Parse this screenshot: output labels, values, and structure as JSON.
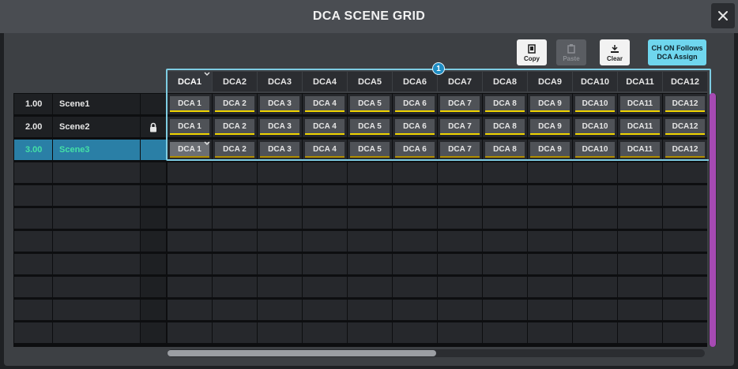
{
  "window": {
    "title": "DCA SCENE GRID"
  },
  "toolbar": {
    "copy_label": "Copy",
    "paste_label": "Paste",
    "clear_label": "Clear",
    "ch_on_line1": "CH ON Follows",
    "ch_on_line2": "DCA Assign"
  },
  "callout": "1",
  "columns": [
    "DCA1",
    "DCA2",
    "DCA3",
    "DCA4",
    "DCA5",
    "DCA6",
    "DCA7",
    "DCA8",
    "DCA9",
    "DCA10",
    "DCA11",
    "DCA12"
  ],
  "scenes": [
    {
      "number": "1.00",
      "name": "Scene1",
      "locked": false,
      "selected": false,
      "cells": [
        "DCA 1",
        "DCA 2",
        "DCA 3",
        "DCA 4",
        "DCA 5",
        "DCA 6",
        "DCA 7",
        "DCA 8",
        "DCA 9",
        "DCA10",
        "DCA11",
        "DCA12"
      ]
    },
    {
      "number": "2.00",
      "name": "Scene2",
      "locked": true,
      "selected": false,
      "cells": [
        "DCA 1",
        "DCA 2",
        "DCA 3",
        "DCA 4",
        "DCA 5",
        "DCA 6",
        "DCA 7",
        "DCA 8",
        "DCA 9",
        "DCA10",
        "DCA11",
        "DCA12"
      ]
    },
    {
      "number": "3.00",
      "name": "Scene3",
      "locked": false,
      "selected": true,
      "cells": [
        "DCA 1",
        "DCA 2",
        "DCA 3",
        "DCA 4",
        "DCA 5",
        "DCA 6",
        "DCA 7",
        "DCA 8",
        "DCA 9",
        "DCA10",
        "DCA11",
        "DCA12"
      ]
    }
  ],
  "active_column": "DCA1",
  "colors": {
    "accent": "#6fd6ee",
    "selected_row": "#2a7fa6",
    "selected_text": "#44e0a6",
    "assign_line": "#f0d400",
    "scrollbar": "#a64ab3"
  }
}
